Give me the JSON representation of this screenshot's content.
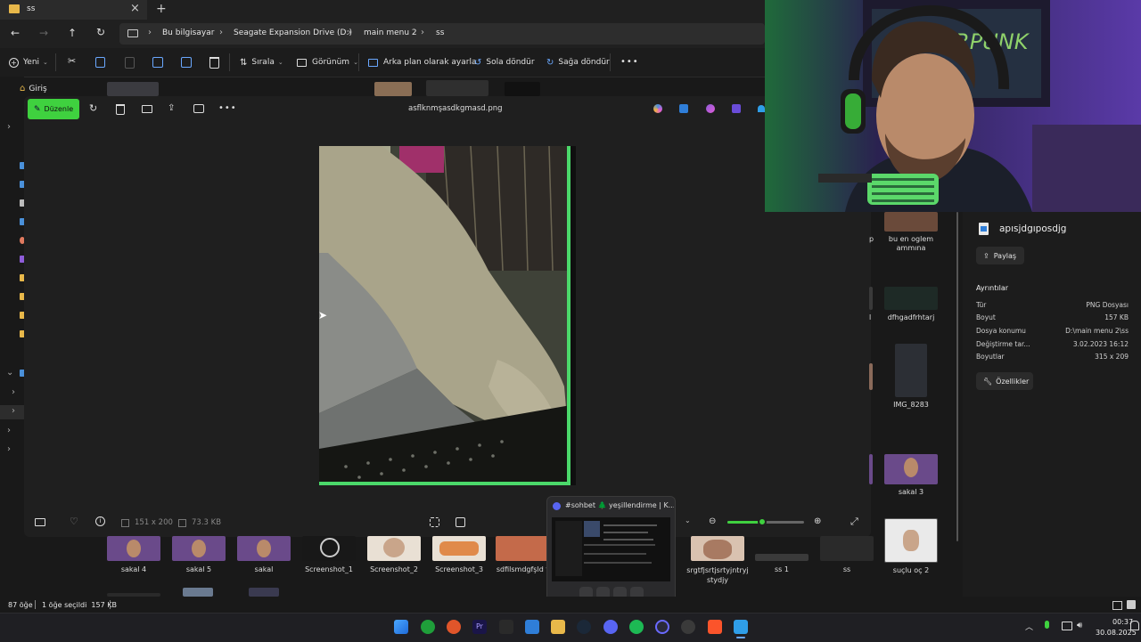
{
  "window": {
    "tab_title": "ss",
    "new_tab": "+",
    "close_tab": "×"
  },
  "breadcrumb": [
    "Bu bilgisayar",
    "Seagate Expansion Drive (D:)",
    "main menu 2",
    "ss"
  ],
  "toolbar": {
    "new": "Yeni",
    "sort": "Sırala",
    "view": "Görünüm",
    "set_background": "Arka plan olarak ayarla",
    "rotate_left": "Sola döndür",
    "rotate_right": "Sağa döndür",
    "more": "•••"
  },
  "sidebar": {
    "home": "Giriş"
  },
  "viewer": {
    "edit_label": "Düzenle",
    "filename": "asflknmşasdkgmasd.png",
    "more": "•••",
    "dimensions": "151 x 200",
    "filesize": "73.3 KB",
    "zoom_level": 0.45
  },
  "thumbnails_bottom": [
    {
      "label": "sakal 4"
    },
    {
      "label": "sakal 5"
    },
    {
      "label": "sakal"
    },
    {
      "label": "Screenshot_1"
    },
    {
      "label": "Screenshot_2"
    },
    {
      "label": "Screenshot_3"
    },
    {
      "label": "sdfilsmdgfşld f"
    },
    {
      "label": "srgtfjsrtjsrtyjntryj stydjy"
    },
    {
      "label": "ss 1"
    },
    {
      "label": "ss"
    },
    {
      "label": "suçlu oç 2"
    }
  ],
  "thumbnails_right": [
    {
      "label": "bu en oglem ammına"
    },
    {
      "label": "dfhgadfrhtarj"
    },
    {
      "label": "IMG_8283"
    },
    {
      "label": "sakal 3"
    }
  ],
  "details": {
    "name": "apısjdgıposdjg",
    "share": "Paylaş",
    "section": "Ayrıntılar",
    "rows": [
      {
        "k": "Tür",
        "v": "PNG Dosyası"
      },
      {
        "k": "Boyut",
        "v": "157 KB"
      },
      {
        "k": "Dosya konumu",
        "v": "D:\\main menu 2\\ss"
      },
      {
        "k": "Değiştirme tar...",
        "v": "3.02.2023 16:12"
      },
      {
        "k": "Boyutlar",
        "v": "315 x 209"
      }
    ],
    "properties": "Özellikler"
  },
  "status": {
    "count": "87 öğe",
    "selected": "1 öğe seçildi  157 KB"
  },
  "popup": {
    "title": "#sohbet 🌲 yeşillendirme | K..."
  },
  "clock": {
    "time": "00:37",
    "date": "30.08.2025"
  },
  "colors": {
    "accent_green": "#22c55e",
    "edit_green": "#3fd13f"
  }
}
